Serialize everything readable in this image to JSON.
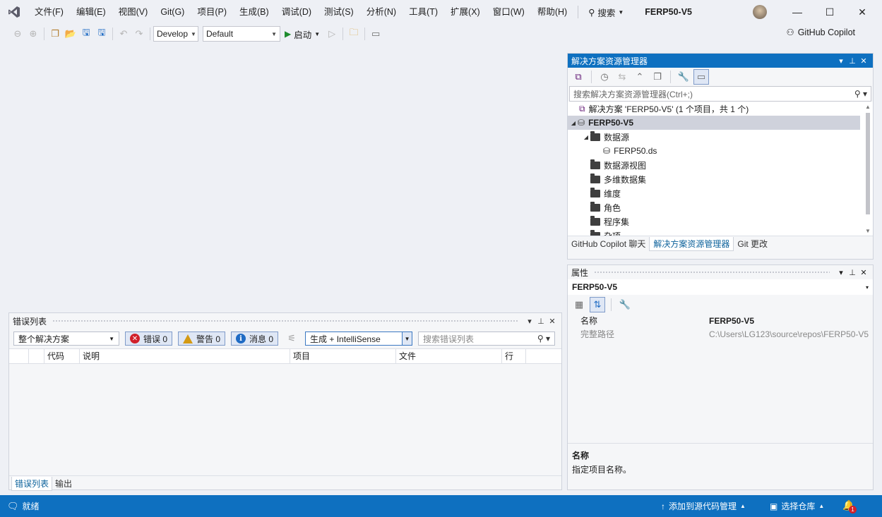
{
  "menu": [
    "文件(F)",
    "编辑(E)",
    "视图(V)",
    "Git(G)",
    "项目(P)",
    "生成(B)",
    "调试(D)",
    "测试(S)",
    "分析(N)",
    "工具(T)",
    "扩展(X)",
    "窗口(W)",
    "帮助(H)"
  ],
  "search_label": "搜索",
  "project_title": "FERP50-V5",
  "toolbar": {
    "config_value": "Develop",
    "platform_value": "Default",
    "start_label": "启动",
    "copilot_label": "GitHub Copilot"
  },
  "error_list": {
    "title": "错误列表",
    "scope_value": "整个解决方案",
    "errors_label": "错误 0",
    "warnings_label": "警告 0",
    "messages_label": "消息 0",
    "build_filter_value": "生成 + IntelliSense",
    "search_placeholder": "搜索错误列表",
    "columns": [
      "",
      "",
      "代码",
      "说明",
      "项目",
      "文件",
      "行"
    ],
    "tabs": [
      "错误列表",
      "输出"
    ]
  },
  "solution_explorer": {
    "title": "解决方案资源管理器",
    "search_placeholder": "搜索解决方案资源管理器(Ctrl+;)",
    "tree": [
      {
        "label": "解决方案 'FERP50-V5' (1 个项目，共 1 个)",
        "level": 0,
        "type": "solution"
      },
      {
        "label": "FERP50-V5",
        "level": 0,
        "type": "project",
        "expanded": true,
        "selected": true
      },
      {
        "label": "数据源",
        "level": 1,
        "type": "folder",
        "expanded": true
      },
      {
        "label": "FERP50.ds",
        "level": 2,
        "type": "file"
      },
      {
        "label": "数据源视图",
        "level": 1,
        "type": "folder"
      },
      {
        "label": "多维数据集",
        "level": 1,
        "type": "folder"
      },
      {
        "label": "维度",
        "level": 1,
        "type": "folder"
      },
      {
        "label": "角色",
        "level": 1,
        "type": "folder"
      },
      {
        "label": "程序集",
        "level": 1,
        "type": "folder"
      },
      {
        "label": "杂项",
        "level": 1,
        "type": "folder"
      }
    ],
    "tabs": [
      "GitHub Copilot 聊天",
      "解决方案资源管理器",
      "Git 更改"
    ]
  },
  "properties": {
    "title": "属性",
    "object": "FERP50-V5",
    "rows": [
      {
        "key": "名称",
        "value": "FERP50-V5"
      },
      {
        "key": "完整路径",
        "value": "C:\\Users\\LG123\\source\\repos\\FERP50-V5"
      }
    ],
    "desc_title": "名称",
    "desc_text": "指定项目名称。"
  },
  "status": {
    "ready": "就绪",
    "add_source_control": "添加到源代码管理",
    "select_repo": "选择仓库",
    "notifications": "1"
  },
  "colors": {
    "accent": "#0e70c0",
    "error": "#d1202a",
    "warning": "#d49a14",
    "info": "#1f6bc4"
  }
}
